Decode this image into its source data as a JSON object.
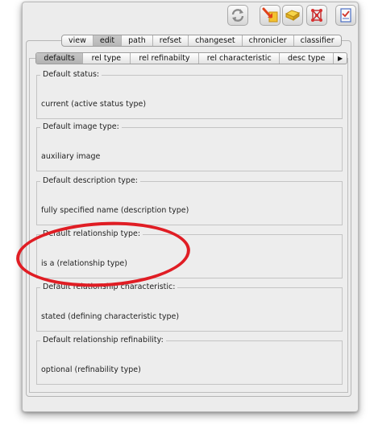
{
  "toolbar": {
    "icons": [
      "sync-icon",
      "commit-icon",
      "folder-icon",
      "classifier-icon",
      "checklist-icon"
    ]
  },
  "tabs": {
    "items": [
      {
        "label": "view"
      },
      {
        "label": "edit",
        "selected": true
      },
      {
        "label": "path"
      },
      {
        "label": "refset"
      },
      {
        "label": "changeset"
      },
      {
        "label": "chronicler"
      },
      {
        "label": "classifier"
      }
    ]
  },
  "subtabs": {
    "items": [
      {
        "label": "defaults",
        "selected": true
      },
      {
        "label": "rel type"
      },
      {
        "label": "rel refinabilty"
      },
      {
        "label": "rel characteristic"
      },
      {
        "label": "desc type"
      }
    ],
    "more": "▶"
  },
  "defaults": [
    {
      "label": "Default status:",
      "value": "current (active status type)"
    },
    {
      "label": "Default image type:",
      "value": "auxiliary image"
    },
    {
      "label": "Default description type:",
      "value": "fully specified name (description type)"
    },
    {
      "label": "Default relationship type:",
      "value": "is a (relationship type)"
    },
    {
      "label": "Default relationship characteristic:",
      "value": "stated (defining characteristic type)"
    },
    {
      "label": "Default relationship refinability:",
      "value": "optional (refinability type)"
    }
  ],
  "annotation": {
    "color": "#e01d24"
  }
}
